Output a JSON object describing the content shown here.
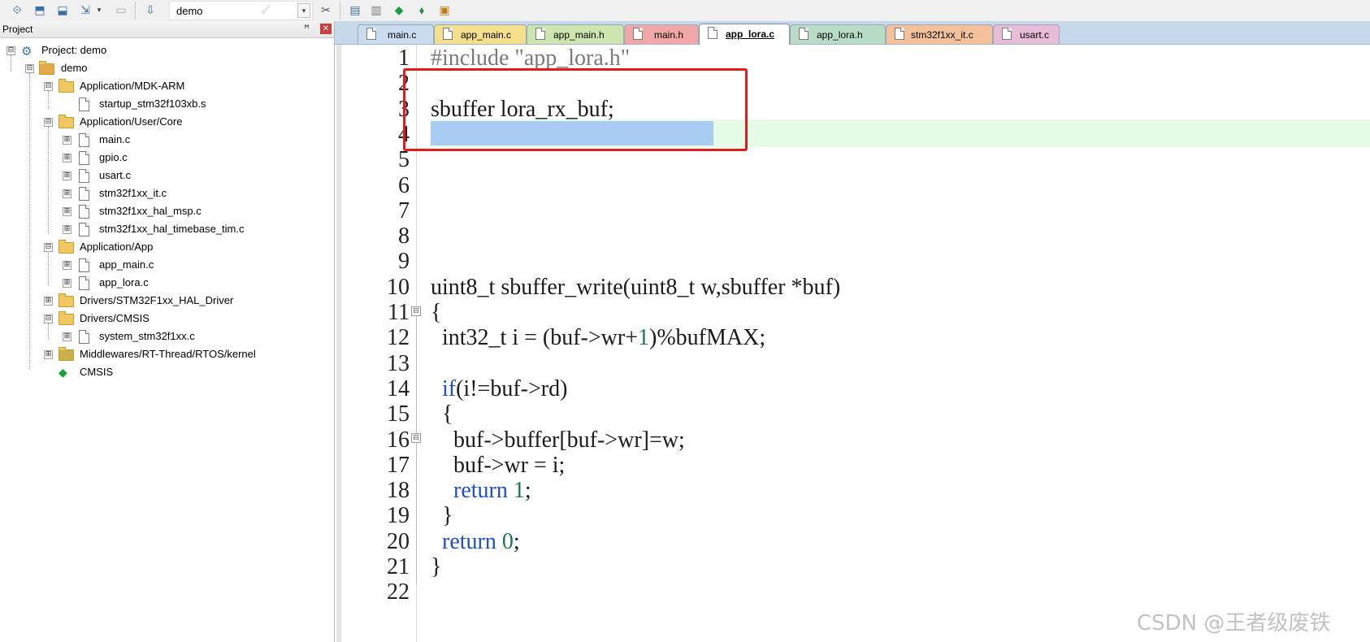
{
  "toolbar": {
    "target_name": "demo",
    "buttons": [
      "build-icon",
      "rebuild-icon",
      "batch-build-icon",
      "load-icon",
      "options-icon",
      "manage-icon",
      "run-icon",
      "debug-icon",
      "settings-icon",
      "package-icon"
    ]
  },
  "project_pane": {
    "title": "Project",
    "pin_glyph": "ᵖ",
    "close_glyph": "✕",
    "tree": [
      {
        "label": "Project: demo",
        "kind": "project",
        "depth": 0,
        "expander": "⊟"
      },
      {
        "label": "demo",
        "kind": "target",
        "depth": 1,
        "expander": "⊟"
      },
      {
        "label": "Application/MDK-ARM",
        "kind": "folder",
        "depth": 2,
        "expander": "⊟"
      },
      {
        "label": "startup_stm32f103xb.s",
        "kind": "file",
        "depth": 3,
        "expander": ""
      },
      {
        "label": "Application/User/Core",
        "kind": "folder",
        "depth": 2,
        "expander": "⊟"
      },
      {
        "label": "main.c",
        "kind": "file",
        "depth": 3,
        "expander": "⊞"
      },
      {
        "label": "gpio.c",
        "kind": "file",
        "depth": 3,
        "expander": "⊞"
      },
      {
        "label": "usart.c",
        "kind": "file",
        "depth": 3,
        "expander": "⊞"
      },
      {
        "label": "stm32f1xx_it.c",
        "kind": "file",
        "depth": 3,
        "expander": "⊞"
      },
      {
        "label": "stm32f1xx_hal_msp.c",
        "kind": "file",
        "depth": 3,
        "expander": "⊞"
      },
      {
        "label": "stm32f1xx_hal_timebase_tim.c",
        "kind": "file",
        "depth": 3,
        "expander": "⊞"
      },
      {
        "label": "Application/App",
        "kind": "folder",
        "depth": 2,
        "expander": "⊟"
      },
      {
        "label": "app_main.c",
        "kind": "file",
        "depth": 3,
        "expander": "⊞"
      },
      {
        "label": "app_lora.c",
        "kind": "file",
        "depth": 3,
        "expander": "⊞"
      },
      {
        "label": "Drivers/STM32F1xx_HAL_Driver",
        "kind": "folder",
        "depth": 2,
        "expander": "⊞"
      },
      {
        "label": "Drivers/CMSIS",
        "kind": "folder",
        "depth": 2,
        "expander": "⊟"
      },
      {
        "label": "system_stm32f1xx.c",
        "kind": "file",
        "depth": 3,
        "expander": "⊞"
      },
      {
        "label": "Middlewares/RT-Thread/RTOS/kernel",
        "kind": "folder-pkg",
        "depth": 2,
        "expander": "⊞"
      },
      {
        "label": "CMSIS",
        "kind": "component",
        "depth": 2,
        "expander": ""
      }
    ]
  },
  "editor": {
    "tabs": [
      {
        "label": "main.c",
        "color": "#c9dcf0",
        "active": false
      },
      {
        "label": "app_main.c",
        "color": "#f6df8c",
        "active": false
      },
      {
        "label": "app_main.h",
        "color": "#cfe5b0",
        "active": false
      },
      {
        "label": "main.h",
        "color": "#f2a7a7",
        "active": false
      },
      {
        "label": "app_lora.c",
        "color": "#ffffff",
        "active": true
      },
      {
        "label": "app_lora.h",
        "color": "#b9dcc6",
        "active": false
      },
      {
        "label": "stm32f1xx_it.c",
        "color": "#f4c19a",
        "active": false
      },
      {
        "label": "usart.c",
        "color": "#e8bcd6",
        "active": false
      }
    ],
    "line_numbers": [
      "1",
      "2",
      "3",
      "4",
      "5",
      "6",
      "7",
      "8",
      "9",
      "10",
      "11",
      "12",
      "13",
      "14",
      "15",
      "16",
      "17",
      "18",
      "19",
      "20",
      "21",
      "22"
    ],
    "lines": [
      {
        "n": 1,
        "segments": [
          {
            "t": "#include ",
            "c": "pp"
          },
          {
            "t": "\"app_lora.h\"",
            "c": "str"
          }
        ]
      },
      {
        "n": 2,
        "segments": []
      },
      {
        "n": 3,
        "segments": [
          {
            "t": "sbuffer lora_rx_buf;",
            "c": ""
          }
        ]
      },
      {
        "n": 4,
        "segments": []
      },
      {
        "n": 5,
        "segments": []
      },
      {
        "n": 6,
        "segments": []
      },
      {
        "n": 7,
        "segments": []
      },
      {
        "n": 8,
        "segments": []
      },
      {
        "n": 9,
        "segments": []
      },
      {
        "n": 10,
        "segments": [
          {
            "t": "uint8_t sbuffer_write(uint8_t w,sbuffer *buf)",
            "c": ""
          }
        ]
      },
      {
        "n": 11,
        "segments": [
          {
            "t": "{",
            "c": ""
          }
        ]
      },
      {
        "n": 12,
        "segments": [
          {
            "t": "  int32_t i = (buf->wr+",
            "c": ""
          },
          {
            "t": "1",
            "c": "num"
          },
          {
            "t": ")%bufMAX;",
            "c": ""
          }
        ]
      },
      {
        "n": 13,
        "segments": []
      },
      {
        "n": 14,
        "segments": [
          {
            "t": "  ",
            "c": ""
          },
          {
            "t": "if",
            "c": "kw"
          },
          {
            "t": "(i!=buf->rd)",
            "c": ""
          }
        ]
      },
      {
        "n": 15,
        "segments": [
          {
            "t": "  {",
            "c": ""
          }
        ]
      },
      {
        "n": 16,
        "segments": [
          {
            "t": "    buf->buffer[buf->wr]=w;",
            "c": ""
          }
        ]
      },
      {
        "n": 17,
        "segments": [
          {
            "t": "    buf->wr = i;",
            "c": ""
          }
        ]
      },
      {
        "n": 18,
        "segments": [
          {
            "t": "    ",
            "c": ""
          },
          {
            "t": "return",
            "c": "kw"
          },
          {
            "t": " ",
            "c": ""
          },
          {
            "t": "1",
            "c": "num"
          },
          {
            "t": ";",
            "c": ""
          }
        ]
      },
      {
        "n": 19,
        "segments": [
          {
            "t": "  }",
            "c": ""
          }
        ]
      },
      {
        "n": 20,
        "segments": [
          {
            "t": "  ",
            "c": ""
          },
          {
            "t": "return",
            "c": "kw"
          },
          {
            "t": " ",
            "c": ""
          },
          {
            "t": "0",
            "c": "num"
          },
          {
            "t": ";",
            "c": ""
          }
        ]
      },
      {
        "n": 21,
        "segments": [
          {
            "t": "}",
            "c": ""
          }
        ]
      },
      {
        "n": 22,
        "segments": []
      }
    ]
  },
  "watermark": "CSDN @王者级废铁"
}
